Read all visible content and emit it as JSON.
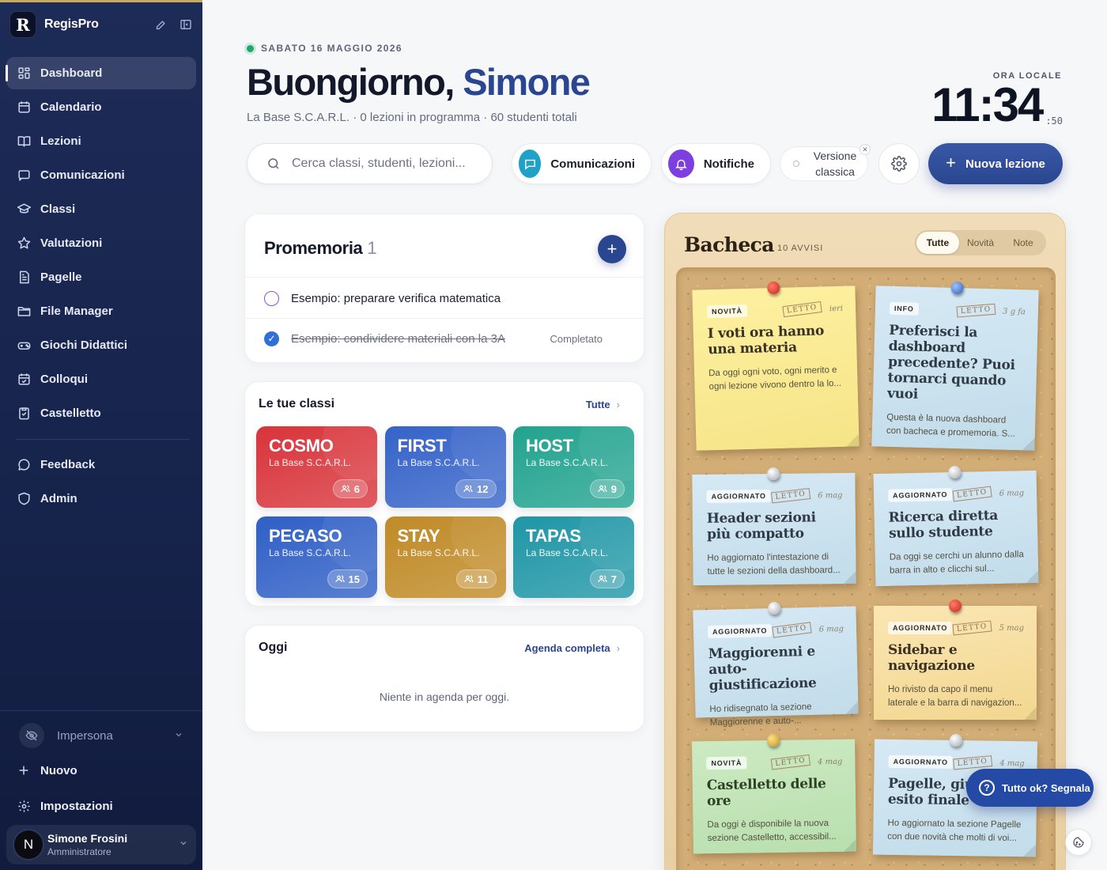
{
  "app": {
    "name": "RegisPro",
    "logo_letter": "R"
  },
  "sidebar": {
    "items": [
      {
        "label": "Dashboard",
        "icon": "grid-icon",
        "active": true
      },
      {
        "label": "Calendario",
        "icon": "calendar-icon"
      },
      {
        "label": "Lezioni",
        "icon": "book-icon"
      },
      {
        "label": "Comunicazioni",
        "icon": "message-icon"
      },
      {
        "label": "Classi",
        "icon": "graduation-cap-icon"
      },
      {
        "label": "Valutazioni",
        "icon": "star-icon"
      },
      {
        "label": "Pagelle",
        "icon": "report-card-icon"
      },
      {
        "label": "File Manager",
        "icon": "folder-icon"
      },
      {
        "label": "Giochi Didattici",
        "icon": "gamepad-icon"
      },
      {
        "label": "Colloqui",
        "icon": "calendar-check-icon"
      },
      {
        "label": "Castelletto",
        "icon": "clipboard-icon"
      }
    ],
    "secondary": [
      {
        "label": "Feedback",
        "icon": "chat-icon"
      },
      {
        "label": "Admin",
        "icon": "shield-icon"
      }
    ],
    "impersona": "Impersona",
    "nuovo": "Nuovo",
    "impostazioni": "Impostazioni",
    "user": {
      "initial": "N",
      "name": "Simone Frosini",
      "role": "Amministratore"
    }
  },
  "header": {
    "date": "SABATO 16 MAGGIO 2026",
    "greeting": "Buongiorno,",
    "name": "Simone",
    "subline": "La Base S.C.A.R.L. · 0 lezioni in programma · 60 studenti totali",
    "clock_label": "ORA LOCALE",
    "clock_hm": "11:34",
    "clock_s": ":50"
  },
  "toolbar": {
    "search_placeholder": "Cerca classi, studenti, lezioni...",
    "comunicazioni": "Comunicazioni",
    "notifiche": "Notifiche",
    "versione_classica": "Versione classica",
    "nuova_lezione": "Nuova lezione",
    "colors": {
      "comunicazioni": "#1fa1c8",
      "notifiche": "#7d3fe0",
      "primary": "#2a4690"
    }
  },
  "promemoria": {
    "title": "Promemoria",
    "count": "1",
    "items": [
      {
        "text": "Esempio: preparare verifica matematica",
        "done": false,
        "status": ""
      },
      {
        "text": "Esempio: condividere materiali con la 3A",
        "done": true,
        "status": "Completato"
      }
    ]
  },
  "classi": {
    "title": "Le tue classi",
    "link": "Tutte",
    "items": [
      {
        "name": "COSMO",
        "school": "La Base S.C.A.R.L.",
        "students": "6",
        "color": "#d8343a"
      },
      {
        "name": "FIRST",
        "school": "La Base S.C.A.R.L.",
        "students": "12",
        "color": "#3563c9"
      },
      {
        "name": "HOST",
        "school": "La Base S.C.A.R.L.",
        "students": "9",
        "color": "#22a38f"
      },
      {
        "name": "PEGASO",
        "school": "La Base S.C.A.R.L.",
        "students": "15",
        "color": "#2f5fc6"
      },
      {
        "name": "STAY",
        "school": "La Base S.C.A.R.L.",
        "students": "11",
        "color": "#c08a26"
      },
      {
        "name": "TAPAS",
        "school": "La Base S.C.A.R.L.",
        "students": "7",
        "color": "#1f96a6"
      }
    ]
  },
  "oggi": {
    "title": "Oggi",
    "link": "Agenda completa",
    "empty": "Niente in agenda per oggi."
  },
  "bacheca": {
    "title": "Bacheca",
    "count": "10 AVVISI",
    "filters": [
      "Tutte",
      "Novità",
      "Note"
    ],
    "active_filter": "Tutte",
    "notes": [
      {
        "tag": "NOVITÀ",
        "stamp": "LETTO",
        "when": "ieri",
        "title": "I voti ora hanno una materia",
        "desc": "Da oggi ogni voto, ogni merito e ogni lezione vivono dentro la lo...",
        "color": "y",
        "pin": "red"
      },
      {
        "tag": "INFO",
        "stamp": "LETTO",
        "when": "3 g fa",
        "title": "Preferisci la dashboard precedente? Puoi tornarci quando vuoi",
        "desc": "Questa è la nuova dashboard con bacheca e promemoria. S...",
        "color": "b",
        "pin": "blue"
      },
      {
        "tag": "AGGIORNATO",
        "stamp": "LETTO",
        "when": "6 mag",
        "title": "Header sezioni più compatto",
        "desc": "Ho aggiornato l'intestazione di tutte le sezioni della dashboard...",
        "color": "b",
        "pin": "gray"
      },
      {
        "tag": "AGGIORNATO",
        "stamp": "LETTO",
        "when": "6 mag",
        "title": "Ricerca diretta sullo studente",
        "desc": "Da oggi se cerchi un alunno dalla barra in alto e clicchi sul...",
        "color": "b",
        "pin": "gray"
      },
      {
        "tag": "AGGIORNATO",
        "stamp": "LETTO",
        "when": "6 mag",
        "title": "Maggiorenni e auto-giustificazione",
        "desc": "Ho ridisegnato la sezione Maggiorenne e auto-...",
        "color": "b",
        "pin": "gray"
      },
      {
        "tag": "AGGIORNATO",
        "stamp": "LETTO",
        "when": "5 mag",
        "title": "Sidebar e navigazione",
        "desc": "Ho rivisto da capo il menu laterale e la barra di navigazion...",
        "color": "a",
        "pin": "red"
      },
      {
        "tag": "NOVITÀ",
        "stamp": "LETTO",
        "when": "4 mag",
        "title": "Castelletto delle ore",
        "desc": "Da oggi è disponibile la nuova sezione Castelletto, accessibil...",
        "color": "g",
        "pin": "gold"
      },
      {
        "tag": "AGGIORNATO",
        "stamp": "LETTO",
        "when": "4 mag",
        "title": "Pagelle, giudizi ed esito finale",
        "desc": "Ho aggiornato la sezione Pagelle con due novità che molti di voi...",
        "color": "b",
        "pin": "gray"
      }
    ]
  },
  "fab": {
    "label": "Tutto ok? Segnala"
  }
}
